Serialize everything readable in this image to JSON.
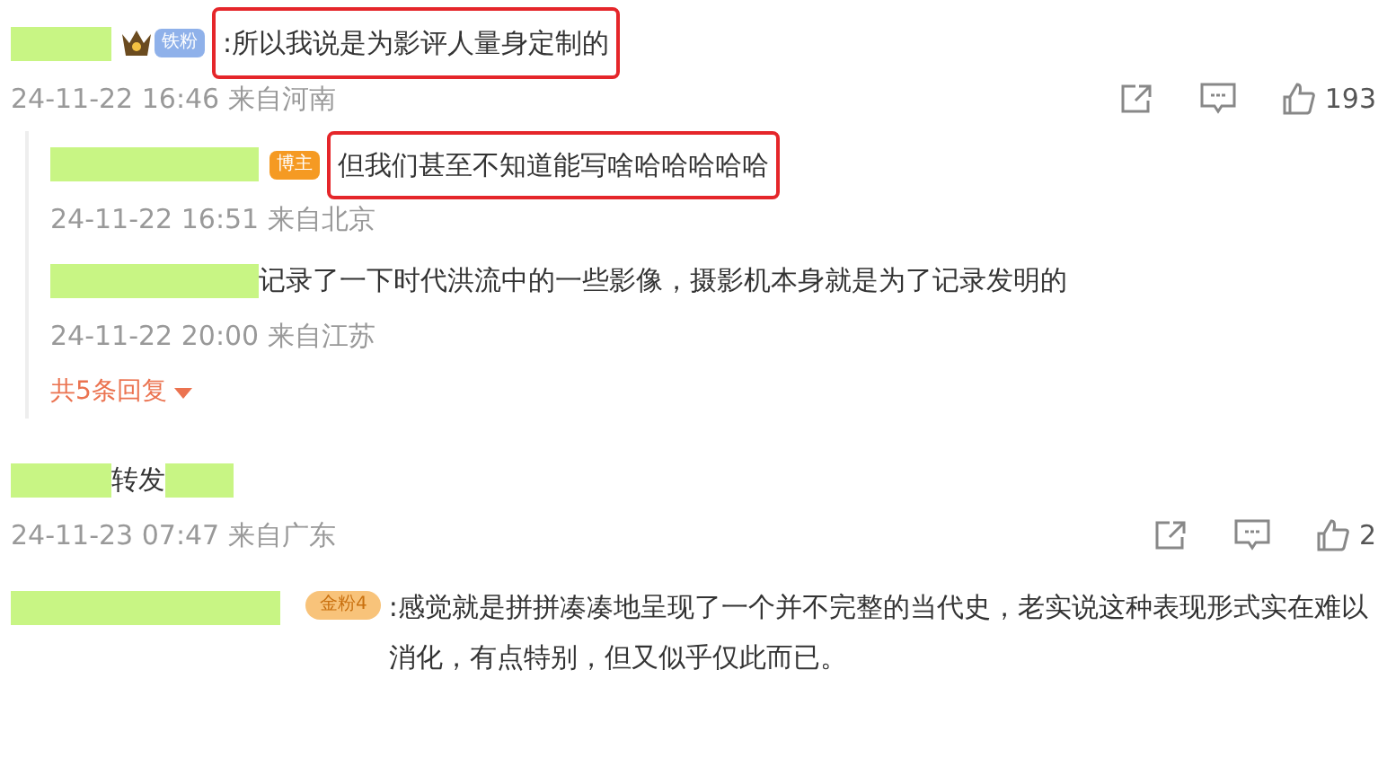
{
  "comments": [
    {
      "badge": {
        "kind": "fan",
        "label": "铁粉"
      },
      "text": ":所以我说是为影评人量身定制的",
      "highlighted": true,
      "trailing_redaction": false,
      "meta": "24-11-22 16:46 来自河南",
      "likes": "193",
      "replies": [
        {
          "badge": {
            "kind": "host",
            "label": "博主"
          },
          "text": "但我们甚至不知道能写啥哈哈哈哈哈",
          "highlighted": true,
          "meta": "24-11-22 16:51 来自北京"
        },
        {
          "text": "记录了一下时代洪流中的一些影像，摄影机本身就是为了记录发明的",
          "highlighted": false,
          "meta": "24-11-22 20:00 来自江苏"
        }
      ],
      "more_replies": "共5条回复"
    },
    {
      "text": "转发",
      "highlighted": false,
      "trailing_redaction": true,
      "meta": "24-11-23 07:47 来自广东",
      "likes": "2"
    },
    {
      "badge": {
        "kind": "gold",
        "label": "金粉4"
      },
      "text": ":感觉就是拼拼凑凑地呈现了一个并不完整的当代史，老实说这种表现形式实在难以消化，有点特别，但又似乎仅此而已。",
      "highlighted": false,
      "trailing_redaction": false
    }
  ]
}
